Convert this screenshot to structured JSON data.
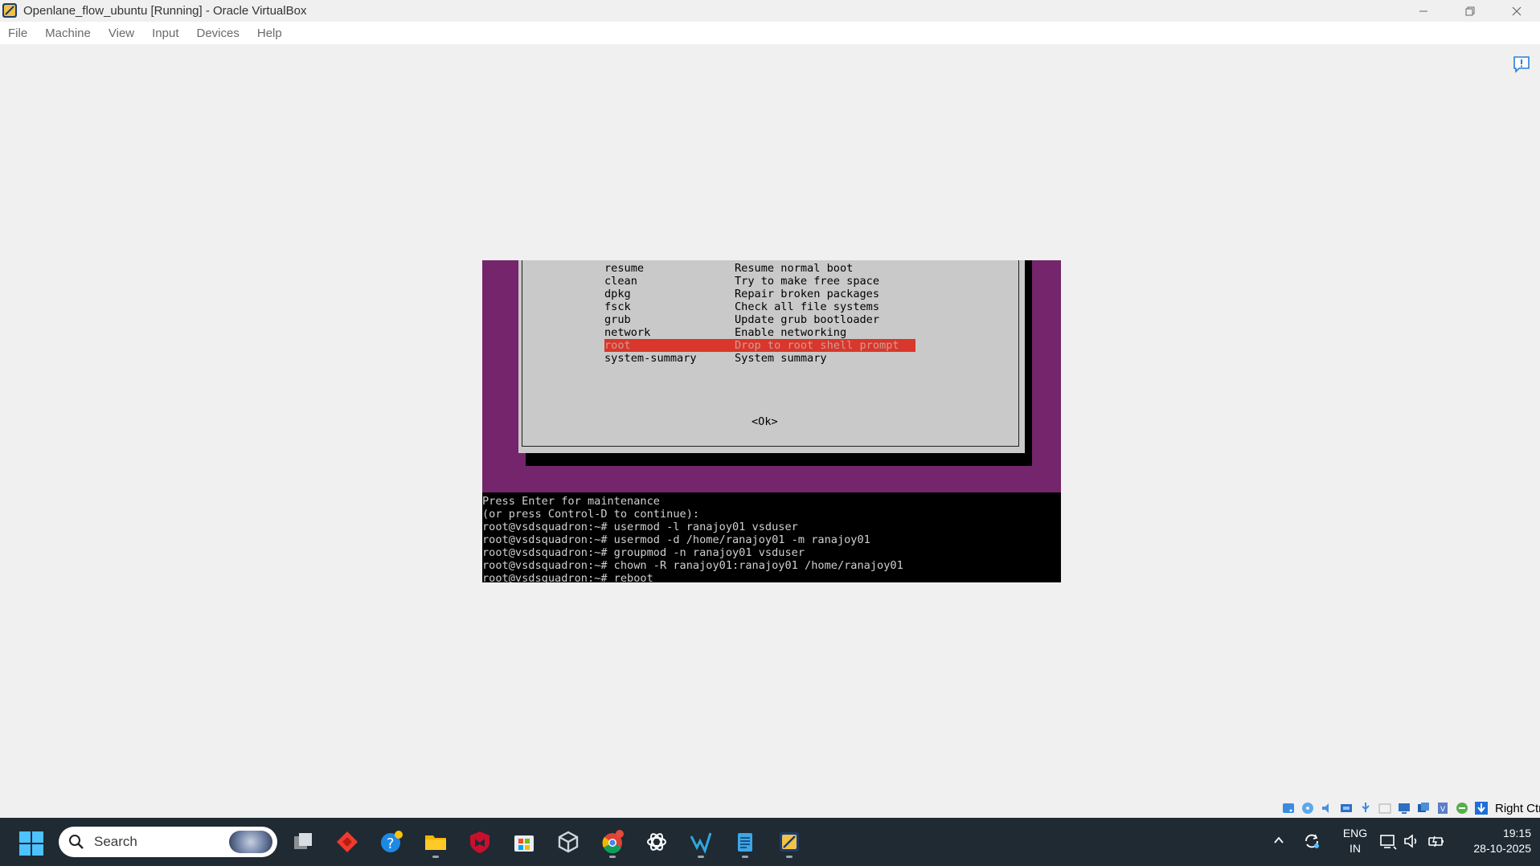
{
  "window": {
    "title": "Openlane_flow_ubuntu [Running] - Oracle VirtualBox",
    "controls": [
      "minimize-icon",
      "restore-icon",
      "close-icon"
    ]
  },
  "menubar": {
    "items": [
      "File",
      "Machine",
      "View",
      "Input",
      "Devices",
      "Help"
    ]
  },
  "vm": {
    "recovery_menu": [
      {
        "key": "resume",
        "desc": "Resume normal boot",
        "selected": false
      },
      {
        "key": "clean",
        "desc": "Try to make free space",
        "selected": false
      },
      {
        "key": "dpkg",
        "desc": "Repair broken packages",
        "selected": false
      },
      {
        "key": "fsck",
        "desc": "Check all file systems",
        "selected": false
      },
      {
        "key": "grub",
        "desc": "Update grub bootloader",
        "selected": false
      },
      {
        "key": "network",
        "desc": "Enable networking",
        "selected": false
      },
      {
        "key": "root",
        "desc": "Drop to root shell prompt",
        "selected": true
      },
      {
        "key": "system-summary",
        "desc": "System summary",
        "selected": false
      }
    ],
    "ok_label": "<Ok>",
    "terminal": [
      "Press Enter for maintenance",
      "(or press Control-D to continue):",
      "root@vsdsquadron:~# usermod -l ranajoy01 vsduser",
      "root@vsdsquadron:~# usermod -d /home/ranajoy01 -m ranajoy01",
      "root@vsdsquadron:~# groupmod -n ranajoy01 vsduser",
      "root@vsdsquadron:~# chown -R ranajoy01:ranajoy01 /home/ranajoy01",
      "root@vsdsquadron:~# reboot"
    ]
  },
  "statusbar": {
    "icons": [
      "hard-disk-icon",
      "optical-drive-icon",
      "audio-icon",
      "network-icon",
      "usb-icon",
      "shared-folders-icon",
      "display-icon",
      "recording-icon",
      "cpu-icon",
      "mouse-integration-icon",
      "keyboard-capture-icon"
    ],
    "host_key": "Right Ctrl"
  },
  "taskbar": {
    "search_placeholder": "Search",
    "apps": [
      "task-view",
      "anydesk",
      "get-help",
      "file-explorer",
      "mcafee",
      "microsoft-store",
      "virtualbox-extension",
      "google-chrome",
      "chatgpt",
      "visual-studio-code",
      "notepad",
      "virtualbox"
    ],
    "language_line1": "ENG",
    "language_line2": "IN",
    "time": "19:15",
    "date": "28-10-2025"
  },
  "colors": {
    "vm_purple": "#74256b",
    "selection_red": "#d9372b",
    "taskbar": "#1f2a33",
    "accent_blue": "#4cc2ff"
  }
}
